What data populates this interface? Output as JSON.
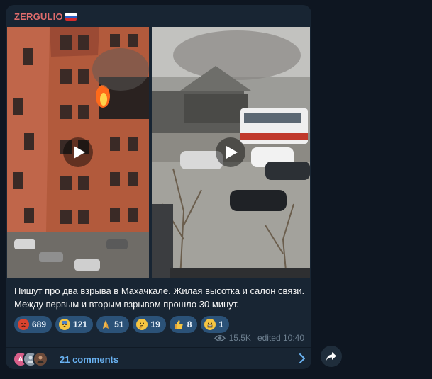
{
  "post": {
    "channel_name": "ZERGULIO",
    "flag_icon": "russia-flag-icon",
    "caption": "Пишут про два взрыва в Махачкале. Жилая высотка и салон связи. Между первым и вторым взрывом прошло 30 минут.",
    "views": "15.5K",
    "edited_time": "edited 10:40"
  },
  "media": [
    {
      "type": "video",
      "description_icon": "play-icon"
    },
    {
      "type": "video",
      "description_icon": "play-icon"
    }
  ],
  "reactions": [
    {
      "emoji": "enraged-face-icon",
      "count": "689",
      "color": "#d9432f"
    },
    {
      "emoji": "fearful-face-icon",
      "count": "121",
      "color": "#f5c542"
    },
    {
      "emoji": "folded-hands-icon",
      "count": "51",
      "color": "#f2b84b"
    },
    {
      "emoji": "thinking-face-icon",
      "count": "19",
      "color": "#f5c542"
    },
    {
      "emoji": "thumbs-up-icon",
      "count": "8",
      "color": "#f5c542"
    },
    {
      "emoji": "grimacing-face-icon",
      "count": "1",
      "color": "#f5c542"
    }
  ],
  "comments": {
    "label": "21 comments",
    "avatars": [
      {
        "initial": "A",
        "color": "#d95f8a"
      },
      {
        "initial": "",
        "color": "#8a98a6"
      },
      {
        "initial": "",
        "color": "#6b4a3a"
      }
    ]
  },
  "colors": {
    "background": "#0e1621",
    "bubble": "#182533",
    "channel_name": "#e06c6c",
    "accent": "#6ab3f3",
    "reaction_pill": "#2b5278"
  }
}
